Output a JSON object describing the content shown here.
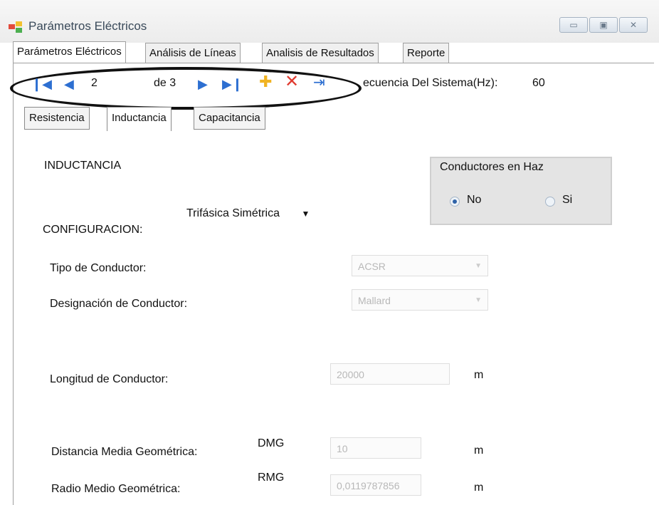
{
  "window": {
    "title": "Parámetros Eléctricos",
    "controls": {
      "minimize": "▭",
      "maximize": "▣",
      "close": "✕"
    }
  },
  "tabs": [
    {
      "label": "Parámetros Eléctricos",
      "active": true
    },
    {
      "label": "Análisis de Líneas"
    },
    {
      "label": "Analisis de Resultados"
    },
    {
      "label": "Reporte"
    }
  ],
  "navigator": {
    "position": "2",
    "count_label": "de 3",
    "icons": [
      "move-first-icon",
      "move-previous-icon",
      "move-next-icon",
      "move-last-icon",
      "add-icon",
      "delete-icon",
      "save-icon"
    ],
    "colors": {
      "nav": "#2d6fd1",
      "add": "#f0b323",
      "delete": "#e03a2f"
    }
  },
  "frequency": {
    "label": "ecuencia Del Sistema(Hz):",
    "value": "60"
  },
  "subtabs": [
    {
      "label": "Resistencia"
    },
    {
      "label": "Inductancia",
      "active": true
    },
    {
      "label": "Capacitancia"
    }
  ],
  "section_title": "INDUCTANCIA",
  "configuration": {
    "label": "CONFIGURACION:",
    "value": "Trifásica Simétrica"
  },
  "bundled": {
    "title": "Conductores en Haz",
    "options": [
      {
        "label": "No",
        "selected": true
      },
      {
        "label": "Si",
        "selected": false
      }
    ]
  },
  "fields": {
    "conductor_type": {
      "label": "Tipo de Conductor:",
      "value": "ACSR"
    },
    "conductor_designation": {
      "label": "Designación de Conductor:",
      "value": "Mallard"
    },
    "conductor_length": {
      "label": "Longitud de Conductor:",
      "value": "20000",
      "unit": "m"
    },
    "dmg": {
      "label": "Distancia Media Geométrica:",
      "tag": "DMG",
      "value": "10",
      "unit": "m"
    },
    "rmg": {
      "label": "Radio Medio Geométrica:",
      "tag": "RMG",
      "value": "0,0119787856",
      "unit": "m"
    }
  }
}
